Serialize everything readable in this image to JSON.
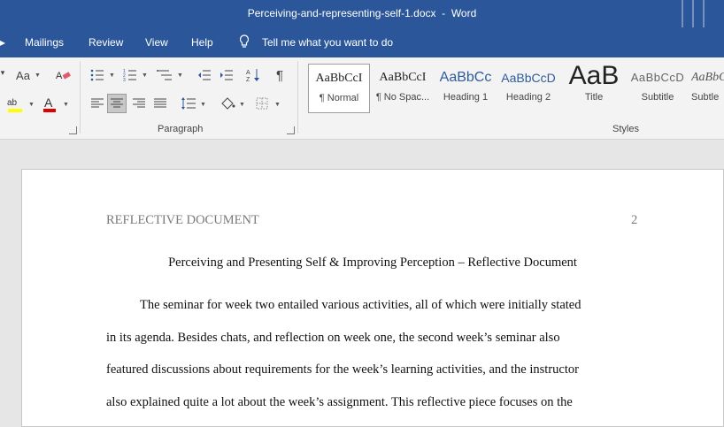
{
  "window": {
    "title": "Perceiving-and-representing-self-1.docx  -  Word"
  },
  "menu": {
    "items": [
      "Mailings",
      "Review",
      "View",
      "Help"
    ],
    "tell_me": "Tell me what you want to do"
  },
  "ribbon": {
    "font_group": {
      "change_case_label": "Aa"
    },
    "paragraph_group": {
      "label": "Paragraph"
    },
    "styles_group": {
      "label": "Styles",
      "styles": [
        {
          "preview": "AaBbCcI",
          "name": "¶ Normal"
        },
        {
          "preview": "AaBbCcI",
          "name": "¶ No Spac..."
        },
        {
          "preview": "AaBbCc",
          "name": "Heading 1"
        },
        {
          "preview": "AaBbCcD",
          "name": "Heading 2"
        },
        {
          "preview": "AaB",
          "name": "Title"
        },
        {
          "preview": "AaBbCcD",
          "name": "Subtitle"
        },
        {
          "preview": "AaBbCcD",
          "name": "Subtle"
        }
      ]
    }
  },
  "document": {
    "header_left": "REFLECTIVE DOCUMENT",
    "page_number": "2",
    "title": "Perceiving and Presenting Self & Improving Perception – Reflective Document",
    "body_lines": [
      "The seminar for week two entailed various activities, all of which were initially stated",
      "in its agenda. Besides chats, and reflection on week one, the second week’s seminar also",
      "featured discussions about requirements for the week’s learning activities, and the instructor",
      "also explained quite a lot about the week’s assignment. This reflective piece focuses on the"
    ]
  },
  "colors": {
    "brand": "#2b579a",
    "ribbon_bg": "#f3f3f3",
    "canvas_bg": "#e6e6e6"
  }
}
